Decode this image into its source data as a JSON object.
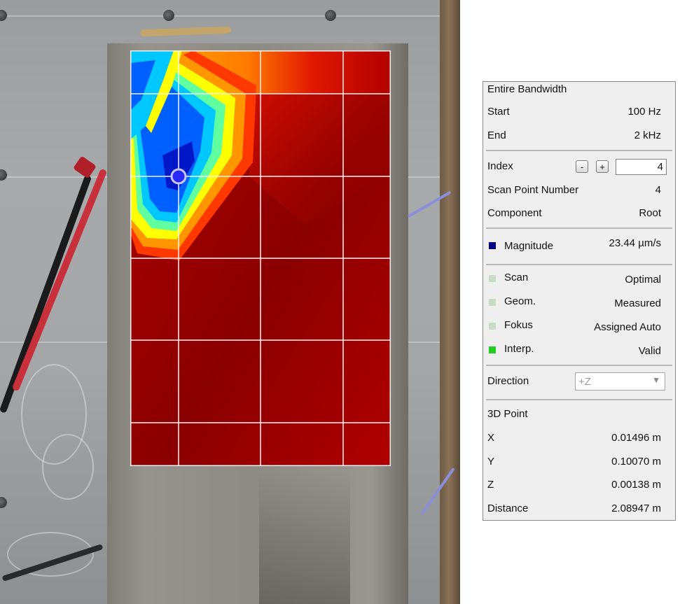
{
  "panel": {
    "bandwidth_title": "Entire Bandwidth",
    "start": {
      "label": "Start",
      "value": "100 Hz"
    },
    "end": {
      "label": "End",
      "value": "2 kHz"
    },
    "index": {
      "label": "Index",
      "minus_label": "-",
      "plus_label": "+",
      "value": "4"
    },
    "scan_point_number": {
      "label": "Scan Point Number",
      "value": "4"
    },
    "component": {
      "label": "Component",
      "value": "Root"
    },
    "magnitude": {
      "label": "Magnitude",
      "value": "23.44 µm/s",
      "color": "#000080"
    },
    "status": [
      {
        "label": "Scan",
        "value": "Optimal",
        "color": "#c8dcc8"
      },
      {
        "label": "Geom.",
        "value": "Measured",
        "color": "#c8dcc8"
      },
      {
        "label": "Fokus",
        "value": "Assigned Auto",
        "color": "#c8dcc8"
      },
      {
        "label": "Interp.",
        "value": "Valid",
        "color": "#22cc22"
      }
    ],
    "direction": {
      "label": "Direction",
      "value": "+Z",
      "dropdown_icon": "chevron-down-icon"
    },
    "point_3d": {
      "title": "3D Point",
      "x": {
        "label": "X",
        "value": "0.01496 m"
      },
      "y": {
        "label": "Y",
        "value": "0.10070 m"
      },
      "z": {
        "label": "Z",
        "value": "0.00138 m"
      },
      "distance": {
        "label": "Distance",
        "value": "2.08947 m"
      }
    }
  },
  "scan_view": {
    "selected_point": 4,
    "colormap": [
      "#0000a0",
      "#0060ff",
      "#00c8ff",
      "#60ffa0",
      "#ffff00",
      "#ff9900",
      "#e01000",
      "#a00000"
    ]
  }
}
